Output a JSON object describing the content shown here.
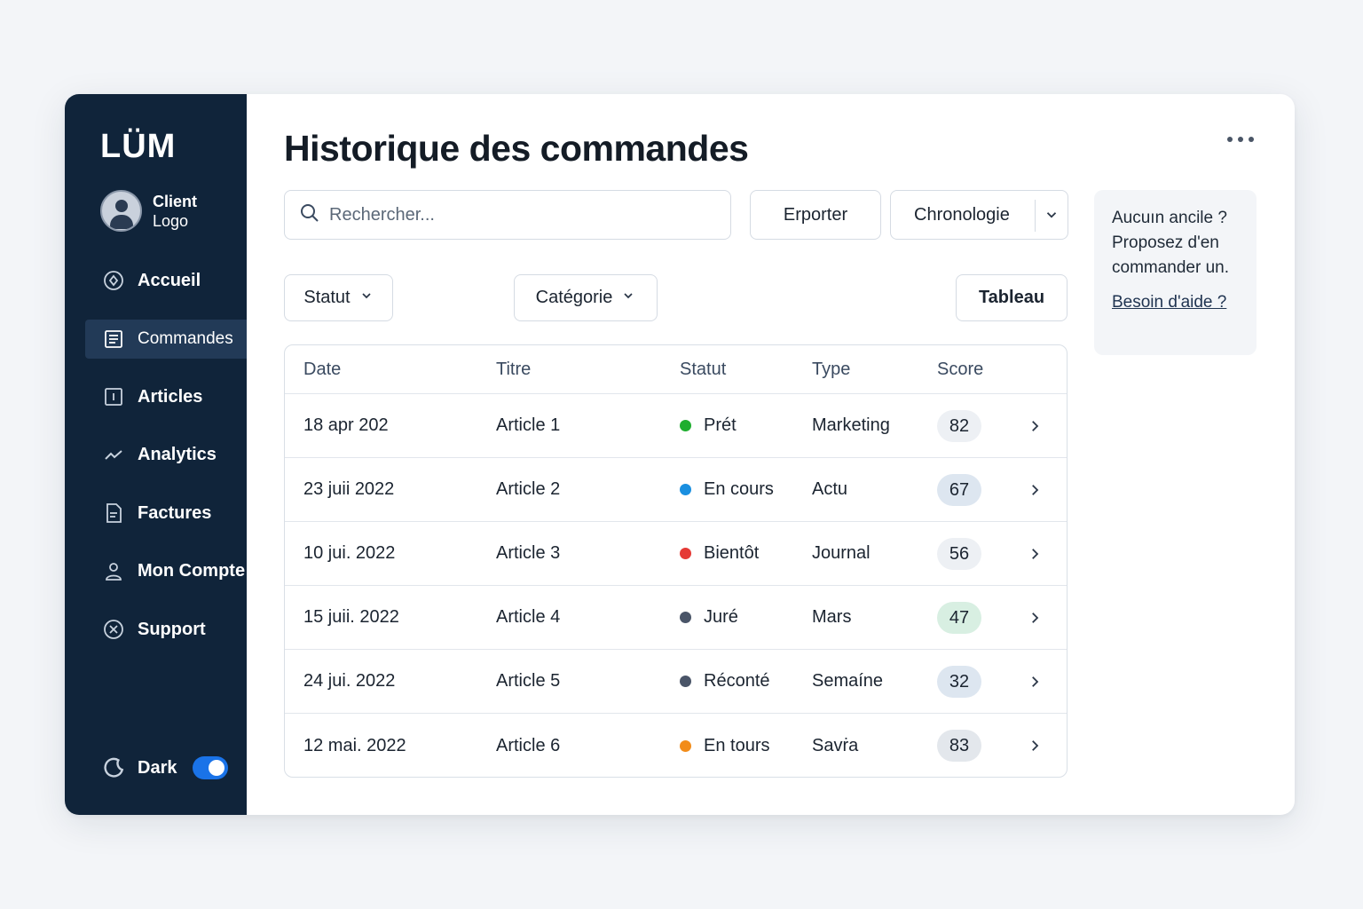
{
  "brand": "LÜM",
  "client": {
    "line1": "Client",
    "line2": "Logo"
  },
  "nav": [
    {
      "label": "Accueil",
      "icon": "home-icon",
      "active": false
    },
    {
      "label": "Commandes",
      "icon": "list-icon",
      "active": true
    },
    {
      "label": "Articles",
      "icon": "article-icon",
      "active": false
    },
    {
      "label": "Analytics",
      "icon": "chart-line-icon",
      "active": false
    },
    {
      "label": "Factures",
      "icon": "invoice-icon",
      "active": false
    },
    {
      "label": "Mon Compte",
      "icon": "user-icon",
      "active": false
    },
    {
      "label": "Support",
      "icon": "support-icon",
      "active": false
    }
  ],
  "theme": {
    "label": "Dark",
    "enabled": true,
    "accent": "#1a73e8"
  },
  "page": {
    "title": "Historique des commandes"
  },
  "search": {
    "placeholder": "Rechercher..."
  },
  "toolbar": {
    "export_label": "Erporter",
    "sort_label": "Chronologie"
  },
  "filters": {
    "status_label": "Statut",
    "category_label": "Catégorie",
    "view_label": "Tableau"
  },
  "table": {
    "headers": {
      "date": "Date",
      "title": "Titre",
      "status": "Statut",
      "type": "Type",
      "score": "Score"
    },
    "rows": [
      {
        "date": "18 apr 202",
        "title": "Article 1",
        "status": "Prét",
        "status_color": "#1fae2f",
        "type": "Marketing",
        "score": "82",
        "score_bg": "#edf0f4"
      },
      {
        "date": "23 juii 2022",
        "title": "Article 2",
        "status": "En cours",
        "status_color": "#1a8fe0",
        "type": "Actu",
        "score": "67",
        "score_bg": "#dde6f0"
      },
      {
        "date": "10 jui. 2022",
        "title": "Article 3",
        "status": "Bientôt",
        "status_color": "#e53935",
        "type": "Journal",
        "score": "56",
        "score_bg": "#edf0f4"
      },
      {
        "date": "15 juii. 2022",
        "title": "Article 4",
        "status": "Juré",
        "status_color": "#4a5568",
        "type": "Mars",
        "score": "47",
        "score_bg": "#d8efe2"
      },
      {
        "date": "24 jui. 2022",
        "title": "Article 5",
        "status": "Réconté",
        "status_color": "#4a5568",
        "type": "Semaíne",
        "score": "32",
        "score_bg": "#dde6f0"
      },
      {
        "date": "12 mai. 2022",
        "title": "Article 6",
        "status": "En tours",
        "status_color": "#f28c1a",
        "type": "Savṙa",
        "score": "83",
        "score_bg": "#e3e7ec"
      }
    ]
  },
  "help": {
    "text": "Aucuın ancile ? Proposez d'en commander un.",
    "link": "Besoin d'aide ?"
  }
}
